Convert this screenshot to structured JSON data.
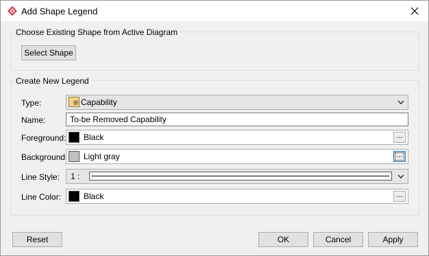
{
  "window": {
    "title": "Add Shape Legend"
  },
  "existing_group": {
    "title": "Choose Existing Shape from Active Diagram",
    "select_label": "Select Shape"
  },
  "new_group": {
    "title": "Create New Legend",
    "type": {
      "label": "Type:",
      "value": "Capability",
      "icon": "capability-icon"
    },
    "name": {
      "label": "Name:",
      "value": "To-be Removed Capability"
    },
    "foreground": {
      "label": "Foreground:",
      "value": "Black",
      "swatch": "#000000",
      "more": "..."
    },
    "background": {
      "label": "Background:",
      "value": "Light gray",
      "swatch": "#c0c0c0",
      "more": "..."
    },
    "line_style": {
      "label": "Line Style:",
      "value": "1 :"
    },
    "line_color": {
      "label": "Line Color:",
      "value": "Black",
      "swatch": "#000000",
      "more": "..."
    }
  },
  "footer": {
    "reset": "Reset",
    "ok": "OK",
    "cancel": "Cancel",
    "apply": "Apply"
  },
  "colors": {
    "accent": "#0078d7",
    "brand_icon": "#d9363e"
  }
}
